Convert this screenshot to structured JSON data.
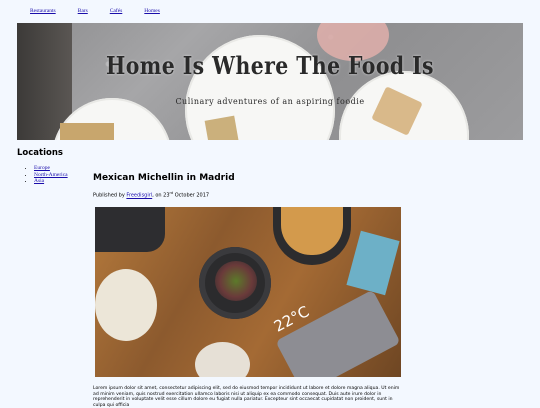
{
  "nav": {
    "items": [
      {
        "label": "Restaurants"
      },
      {
        "label": "Bars"
      },
      {
        "label": "Cafés"
      },
      {
        "label": "Homes"
      }
    ]
  },
  "hero": {
    "title": "Home Is Where The Food Is",
    "subtitle": "Culinary adventures of an aspiring foodie"
  },
  "sidebar": {
    "heading": "Locations",
    "items": [
      {
        "label": "Europe"
      },
      {
        "label": "North-America"
      },
      {
        "label": "Asia"
      }
    ]
  },
  "post": {
    "title": "Mexican Michellin in Madrid",
    "meta_prefix": "Published by ",
    "author": "Freedisgirl",
    "meta_mid": ", on 23",
    "meta_sup": "rd",
    "meta_suffix": " October 2017",
    "photo_caption_temp": "22°C",
    "body": "Lorem ipsum dolor sit amet, consectetur adipiscing elit, sed do eiusmod tempor incididunt ut labore et dolore magna aliqua. Ut enim ad minim veniam, quis nostrud exercitation ullamco laboris nisi ut aliquip ex ea commodo consequat. Duis aute irure dolor in reprehenderit in voluptate velit esse cillum dolore eu fugiat nulla pariatur. Excepteur sint occaecat cupidatat non proident, sunt in culpa qui officia"
  }
}
